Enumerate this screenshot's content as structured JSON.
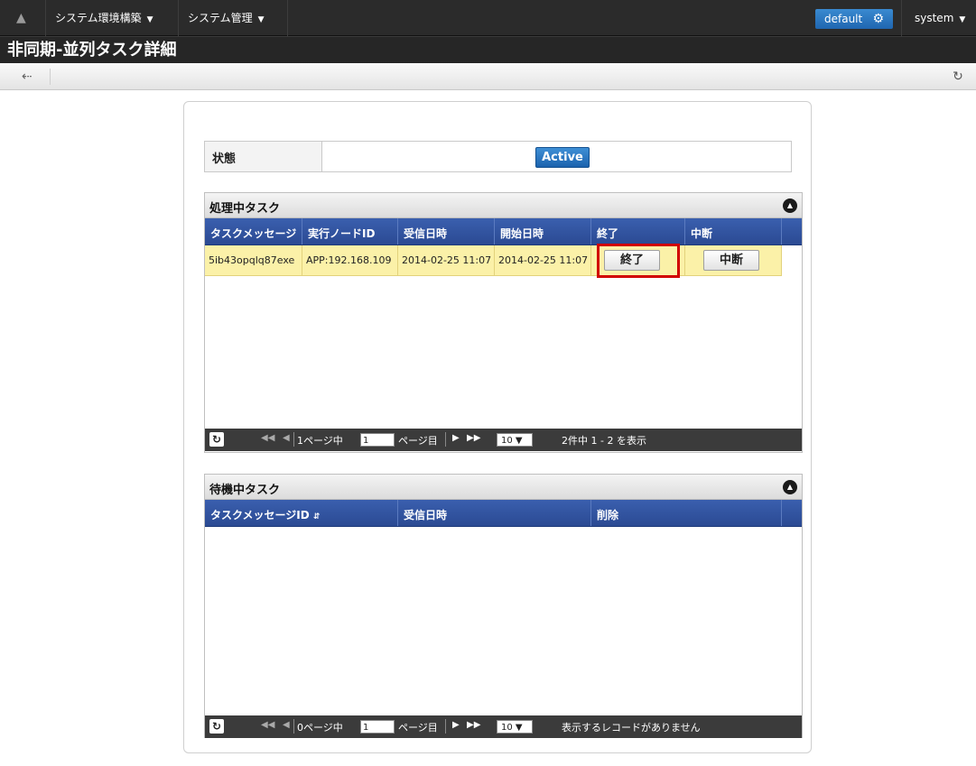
{
  "nav": {
    "menu1": "システム環境構築",
    "menu2": "システム管理",
    "tenant": "default",
    "user": "system"
  },
  "page": {
    "title": "非同期-並列タスク詳細"
  },
  "status": {
    "label": "状態",
    "value": "Active"
  },
  "processing": {
    "title": "処理中タスク",
    "columns": [
      "タスクメッセージ",
      "実行ノードID",
      "受信日時",
      "開始日時",
      "終了",
      "中断"
    ],
    "rows": [
      {
        "message_id": "5ib43opqlq87exe",
        "node_id": "APP:192.168.109",
        "received": "2014-02-25 11:07",
        "started": "2014-02-25 11:07",
        "finish_label": "終了",
        "abort_label": "中断"
      }
    ],
    "pager": {
      "page_prefix": "1ページ中",
      "page_value": "1",
      "page_suffix": "ページ目",
      "per_page": "10",
      "summary": "2件中 1 - 2 を表示"
    }
  },
  "waiting": {
    "title": "待機中タスク",
    "columns": [
      "タスクメッセージID",
      "受信日時",
      "削除"
    ],
    "pager": {
      "page_prefix": "0ページ中",
      "page_value": "1",
      "page_suffix": "ページ目",
      "per_page": "10",
      "summary": "表示するレコードがありません"
    }
  },
  "colors": {
    "header_blue": "#2b4a93",
    "row_yellow": "#fbf1a8",
    "highlight_red": "#d10000",
    "active_blue": "#1f66b0"
  }
}
